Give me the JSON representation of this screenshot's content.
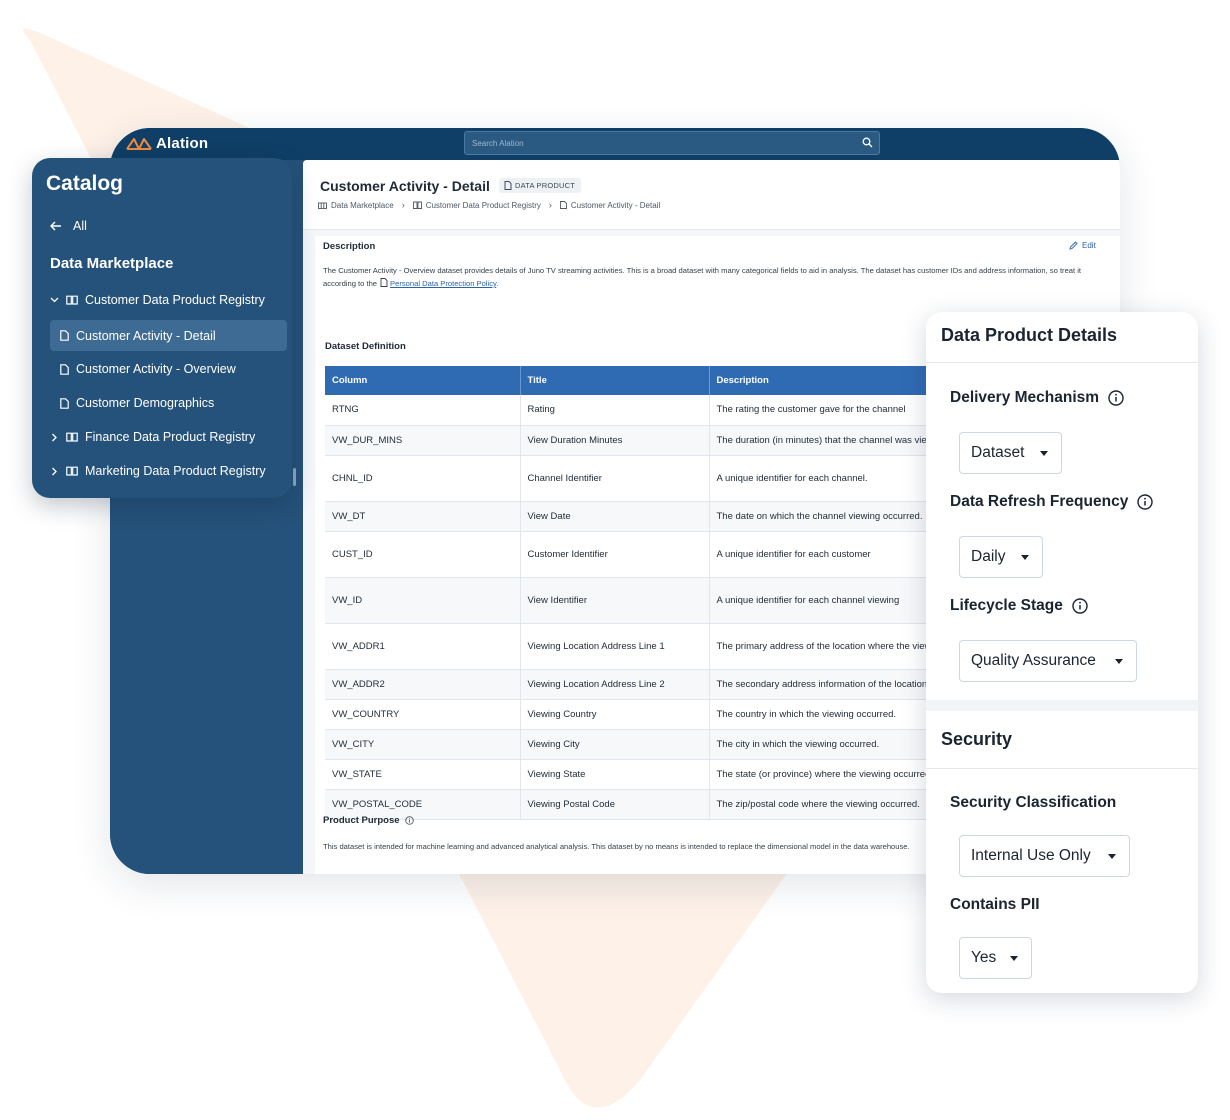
{
  "app": {
    "logo_text": "Alation",
    "search_placeholder": "Search Alation"
  },
  "page": {
    "title": "Customer Activity - Detail",
    "badge": "DATA PRODUCT",
    "breadcrumb": [
      "Data Marketplace",
      "Customer Data Product Registry",
      "Customer Activity - Detail"
    ]
  },
  "description": {
    "label": "Description",
    "edit_label": "Edit",
    "text_part1": "The Customer Activity - Overview dataset provides details of Juno TV streaming activities. This is a broad dataset with many categorical fields to aid in analysis. The dataset has customer IDs and address information, so treat it according to the",
    "link_text": "Personal Data Protection Policy",
    "text_end": "."
  },
  "dataset_definition": {
    "label": "Dataset Definition",
    "headers": [
      "Column",
      "Title",
      "Description"
    ],
    "rows": [
      [
        "RTNG",
        "Rating",
        "The rating the customer gave for the channel"
      ],
      [
        "VW_DUR_MINS",
        "View Duration Minutes",
        "The duration (in minutes) that the channel was viewed"
      ],
      [
        "CHNL_ID",
        "Channel Identifier",
        "A unique identifier for each channel."
      ],
      [
        "VW_DT",
        "View Date",
        "The date on which the channel viewing occurred."
      ],
      [
        "CUST_ID",
        "Customer Identifier",
        "A unique identifier for each customer"
      ],
      [
        "VW_ID",
        "View Identifier",
        "A unique identifier for each channel viewing"
      ],
      [
        "VW_ADDR1",
        "Viewing Location Address Line 1",
        "The primary address of the location where the viewing occurred"
      ],
      [
        "VW_ADDR2",
        "Viewing Location Address Line 2",
        "The secondary address information of the location"
      ],
      [
        "VW_COUNTRY",
        "Viewing Country",
        "The country in which the viewing occurred."
      ],
      [
        "VW_CITY",
        "Viewing City",
        "The city in which the viewing occurred."
      ],
      [
        "VW_STATE",
        "Viewing State",
        "The state (or province) where the viewing occurred."
      ],
      [
        "VW_POSTAL_CODE",
        "Viewing Postal Code",
        "The zip/postal code where the viewing occurred."
      ]
    ]
  },
  "product_purpose": {
    "label": "Product Purpose",
    "text": "This dataset is intended for machine learning and advanced analytical analysis. This dataset by no means is intended to replace the dimensional model in the data warehouse."
  },
  "catalog": {
    "title": "Catalog",
    "all_label": "All",
    "section_title": "Data Marketplace",
    "registry_open": "Customer Data Product Registry",
    "children": [
      "Customer Activity - Detail",
      "Customer Activity - Overview",
      "Customer Demographics"
    ],
    "registry_finance": "Finance Data Product Registry",
    "registry_marketing": "Marketing Data Product Registry"
  },
  "details": {
    "heading": "Data Product Details",
    "delivery_label": "Delivery Mechanism",
    "delivery_value": "Dataset",
    "refresh_label": "Data Refresh Frequency",
    "refresh_value": "Daily",
    "lifecycle_label": "Lifecycle Stage",
    "lifecycle_value": "Quality Assurance",
    "security_heading": "Security",
    "classification_label": "Security Classification",
    "classification_value": "Internal Use Only",
    "pii_label": "Contains PII",
    "pii_value": "Yes"
  },
  "colors": {
    "navy": "#0f3f66",
    "sidebar": "#25527a",
    "table_header": "#2f6bb3",
    "link": "#2b64a8",
    "background_shape": "#fdf1e8"
  }
}
